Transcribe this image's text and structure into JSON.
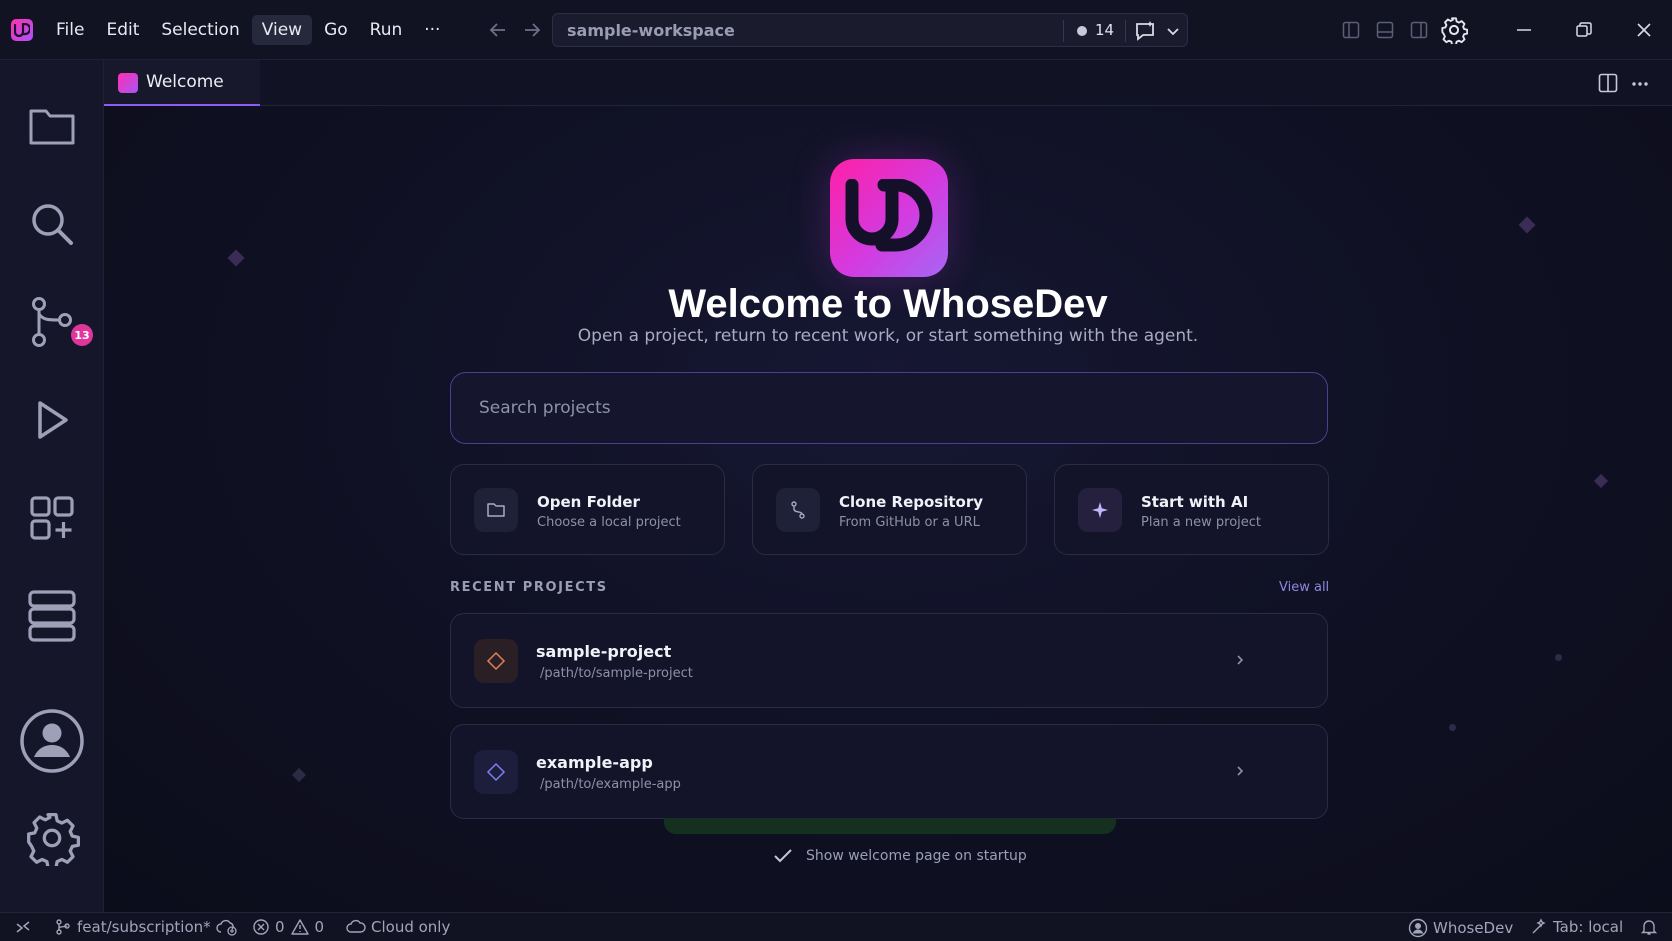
{
  "app": {
    "icon": "whosedev-logo-icon"
  },
  "menu": {
    "items": [
      {
        "label": "File"
      },
      {
        "label": "Edit"
      },
      {
        "label": "Selection"
      },
      {
        "label": "View",
        "active": true
      },
      {
        "label": "Go"
      },
      {
        "label": "Run"
      },
      {
        "label": "···"
      }
    ]
  },
  "command_center": {
    "title": "sample-workspace",
    "count": "14"
  },
  "activity_bar": {
    "items": [
      "folder-icon",
      "search-icon",
      "source-control-icon",
      "run-icon",
      "extensions-icon",
      "database-icon",
      "account-icon",
      "settings-icon"
    ],
    "source_control_badge": "13"
  },
  "tabs": [
    {
      "label": "Welcome",
      "active": true
    }
  ],
  "welcome": {
    "title": "Welcome to WhoseDev",
    "subtitle": "Open a project, return to recent work, or start something with the agent.",
    "search_placeholder": "Search projects",
    "actions": [
      {
        "title": "Open Folder",
        "subtitle": "Choose a local project",
        "icon": "folder-icon"
      },
      {
        "title": "Clone Repository",
        "subtitle": "From GitHub or a URL",
        "icon": "git-branch-icon"
      },
      {
        "title": "Start with AI",
        "subtitle": "Plan a new project",
        "icon": "sparkle-icon"
      }
    ],
    "recent_header": "RECENT PROJECTS",
    "view_all": "View all",
    "recent": [
      {
        "name": "sample-project",
        "path": "/path/to/sample-project",
        "icon_color": "#e0805a"
      },
      {
        "name": "example-app",
        "path": "/path/to/example-app",
        "icon_color": "#7b7ff0"
      }
    ],
    "show_on_startup": "Show welcome page on startup"
  },
  "status_bar": {
    "branch": "feat/subscription*",
    "errors": "0",
    "warnings": "0",
    "cloud": "Cloud only",
    "account": "WhoseDev",
    "tab_mode": "Tab: local"
  },
  "colors": {
    "accent": "#8b5cf6",
    "brand_pink": "#ff2fb0",
    "badge": "#e0359b"
  }
}
